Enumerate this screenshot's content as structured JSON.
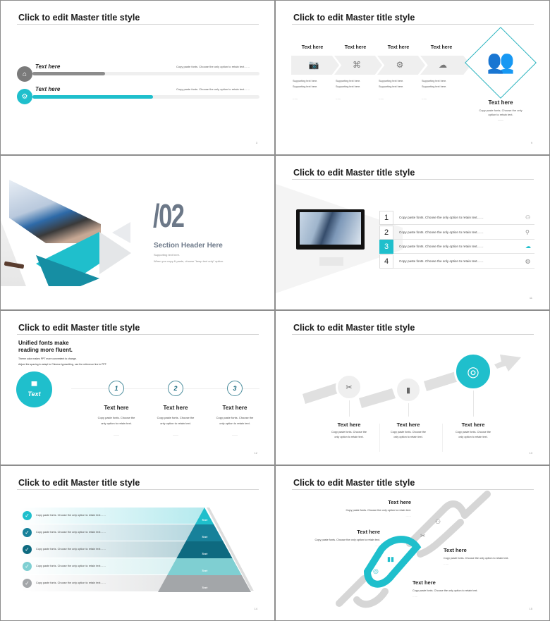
{
  "master_title": "Click to edit Master title style",
  "slides": [
    {
      "page": "3",
      "rows": [
        {
          "label": "Text here",
          "desc": "Copy paste fonts. Choose the only option to retain text……",
          "progress": 0.32,
          "color": "#8c8c8c",
          "icon": "home-icon"
        },
        {
          "label": "Text here",
          "desc": "Copy paste fonts. Choose the only option to retain text……",
          "progress": 0.53,
          "color": "#1fbfcc",
          "icon": "gears-icon"
        }
      ]
    },
    {
      "page": "9",
      "steps": [
        {
          "label": "Text here",
          "icon": "camera-icon",
          "glyph": "📷",
          "bullets": [
            "Supporting text here.",
            "Supporting text here.",
            "……"
          ]
        },
        {
          "label": "Text here",
          "icon": "hierarchy-icon",
          "glyph": "⌘",
          "bullets": [
            "Supporting text here.",
            "Supporting text here.",
            "……"
          ]
        },
        {
          "label": "Text here",
          "icon": "gears-icon",
          "glyph": "⚙",
          "bullets": [
            "Supporting text here.",
            "Supporting text here.",
            "……"
          ]
        },
        {
          "label": "Text here",
          "icon": "cloud-upload-icon",
          "glyph": "☁",
          "bullets": [
            "Supporting text here.",
            "Supporting text here.",
            "……"
          ]
        }
      ],
      "feature": {
        "title": "Text here",
        "desc": "Copy paste fonts. Choose the only option to retain text.",
        "icon": "team-icon",
        "dash": "——"
      }
    },
    {
      "section_number": "/02",
      "section_title": "Section Header Here",
      "sub1": "Supporting text here.",
      "sub2": "When you copy & paste, choose \"keep text only\" option."
    },
    {
      "page": "11",
      "items": [
        {
          "num": "1",
          "text": "Copy paste fonts. Choose the only option to retain text……",
          "icon": "people-icon",
          "active": false
        },
        {
          "num": "2",
          "text": "Copy paste fonts. Choose the only option to retain text……",
          "icon": "search-doc-icon",
          "active": false
        },
        {
          "num": "3",
          "text": "Copy paste fonts. Choose the only option to retain text……",
          "icon": "cloud-icon",
          "active": true
        },
        {
          "num": "4",
          "text": "Copy paste fonts. Choose the only option to retain text……",
          "icon": "globe-icon",
          "active": false
        }
      ]
    },
    {
      "page": "12",
      "headline": "Unified fonts make reading more fluent.",
      "headline_l1": "Unified fonts make",
      "headline_l2": "reading more fluent.",
      "line1": "Theme color makes PPT more convenient to change.",
      "line2": "Adjust the spacing to adapt to Chinese typesetting, use the reference line in PPT.",
      "badge": "Text",
      "steps": [
        {
          "num": "1",
          "title": "Text here",
          "desc1": "Copy paste fonts. Choose the",
          "desc2": "only option to retain text.",
          "dash": "——"
        },
        {
          "num": "2",
          "title": "Text here",
          "desc1": "Copy paste fonts. Choose the",
          "desc2": "only option to retain text.",
          "dash": "——"
        },
        {
          "num": "3",
          "title": "Text here",
          "desc1": "Copy paste fonts. Choose the",
          "desc2": "only option to retain text.",
          "dash": "——"
        }
      ]
    },
    {
      "page": "13",
      "steps": [
        {
          "title": "Text here",
          "desc1": "Copy paste fonts. Choose the",
          "desc2": "only option to retain text.",
          "icon": "tools-icon",
          "glyph": "✂"
        },
        {
          "title": "Text here",
          "desc1": "Copy paste fonts. Choose the",
          "desc2": "only option to retain text.",
          "icon": "chart-icon",
          "glyph": "▮"
        },
        {
          "title": "Text here",
          "desc1": "Copy paste fonts. Choose the",
          "desc2": "only option to retain text.",
          "icon": "target-icon",
          "glyph": "◎"
        }
      ]
    },
    {
      "page": "14",
      "levels": [
        {
          "text": "Copy paste fonts. Choose the only option to retain text……",
          "label": "Text",
          "color": "#1fbfcc"
        },
        {
          "text": "Copy paste fonts. Choose the only option to retain text……",
          "label": "Text",
          "color": "#17819a"
        },
        {
          "text": "Copy paste fonts. Choose the only option to retain text……",
          "label": "Text",
          "color": "#0e6a80"
        },
        {
          "text": "Copy paste fonts. Choose the only option to retain text……",
          "label": "Text",
          "color": "#7fcfd2"
        },
        {
          "text": "Copy paste fonts. Choose the only option to retain text……",
          "label": "Text",
          "color": "#a3a6a9"
        }
      ]
    },
    {
      "page": "15",
      "items": [
        {
          "title": "Text here",
          "text": "Copy paste fonts. Choose the only option to retain text.",
          "dash": "……"
        },
        {
          "title": "Text here",
          "text": "Copy paste fonts. Choose the only option to retain text.",
          "dash": "……"
        },
        {
          "title": "Text here",
          "text": "Copy paste fonts. Choose the only option to retain text.",
          "dash": "……"
        },
        {
          "title": "Text here",
          "text": "Copy paste fonts. Choose the only option to retain text.",
          "dash": "……"
        }
      ]
    }
  ]
}
